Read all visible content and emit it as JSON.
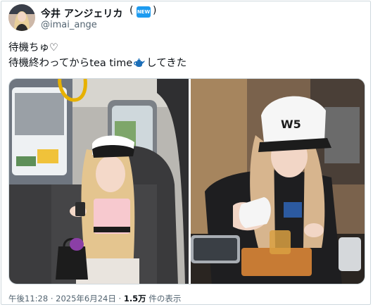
{
  "author": {
    "display_name": "今井 アンジェリカ",
    "handle": "@imai_ange",
    "badge_label": "NEW"
  },
  "tweet": {
    "line1": "待機ちゅ♡",
    "line2_before": "待機終わってからtea time",
    "line2_after": "してきた"
  },
  "media": {
    "photos": [
      "taxi-selfie-photo",
      "cafe-tea-photo"
    ],
    "cap_text": "W5"
  },
  "meta": {
    "time": "午後11:28",
    "separator": "·",
    "date": "2025年6月24日",
    "views_count": "1.5万",
    "views_label": "件の表示"
  },
  "colors": {
    "badge": "#1d9bf0",
    "text": "#0f1419",
    "secondary": "#536471"
  },
  "icons": [
    "teapot-icon"
  ]
}
